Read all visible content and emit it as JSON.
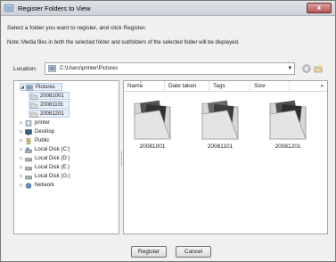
{
  "window": {
    "title": "Register Folders to View",
    "close_label": "x"
  },
  "instruction": "Select a folder you want to register, and click Register.",
  "note": "Note: Media files in both the selected folder and subfolders of the selected folder will be displayed.",
  "location": {
    "label": "Location:",
    "path": "C:\\Users\\printer\\Pictures"
  },
  "tree": {
    "items": [
      {
        "label": "Pictures"
      },
      {
        "label": "20081001"
      },
      {
        "label": "20081101"
      },
      {
        "label": "20081201"
      },
      {
        "label": "printer"
      },
      {
        "label": "Desktop"
      },
      {
        "label": "Public"
      },
      {
        "label": "Local Disk (C:)"
      },
      {
        "label": "Local Disk (D:)"
      },
      {
        "label": "Local Disk (E:)"
      },
      {
        "label": "Local Disk (G:)"
      },
      {
        "label": "Network"
      }
    ]
  },
  "files": {
    "columns": [
      "Name",
      "Date taken",
      "Tags",
      "Size"
    ],
    "more": "»",
    "items": [
      {
        "name": "20081001"
      },
      {
        "name": "20081101"
      },
      {
        "name": "20081201"
      }
    ]
  },
  "buttons": {
    "register": "Register",
    "cancel": "Cancel"
  }
}
